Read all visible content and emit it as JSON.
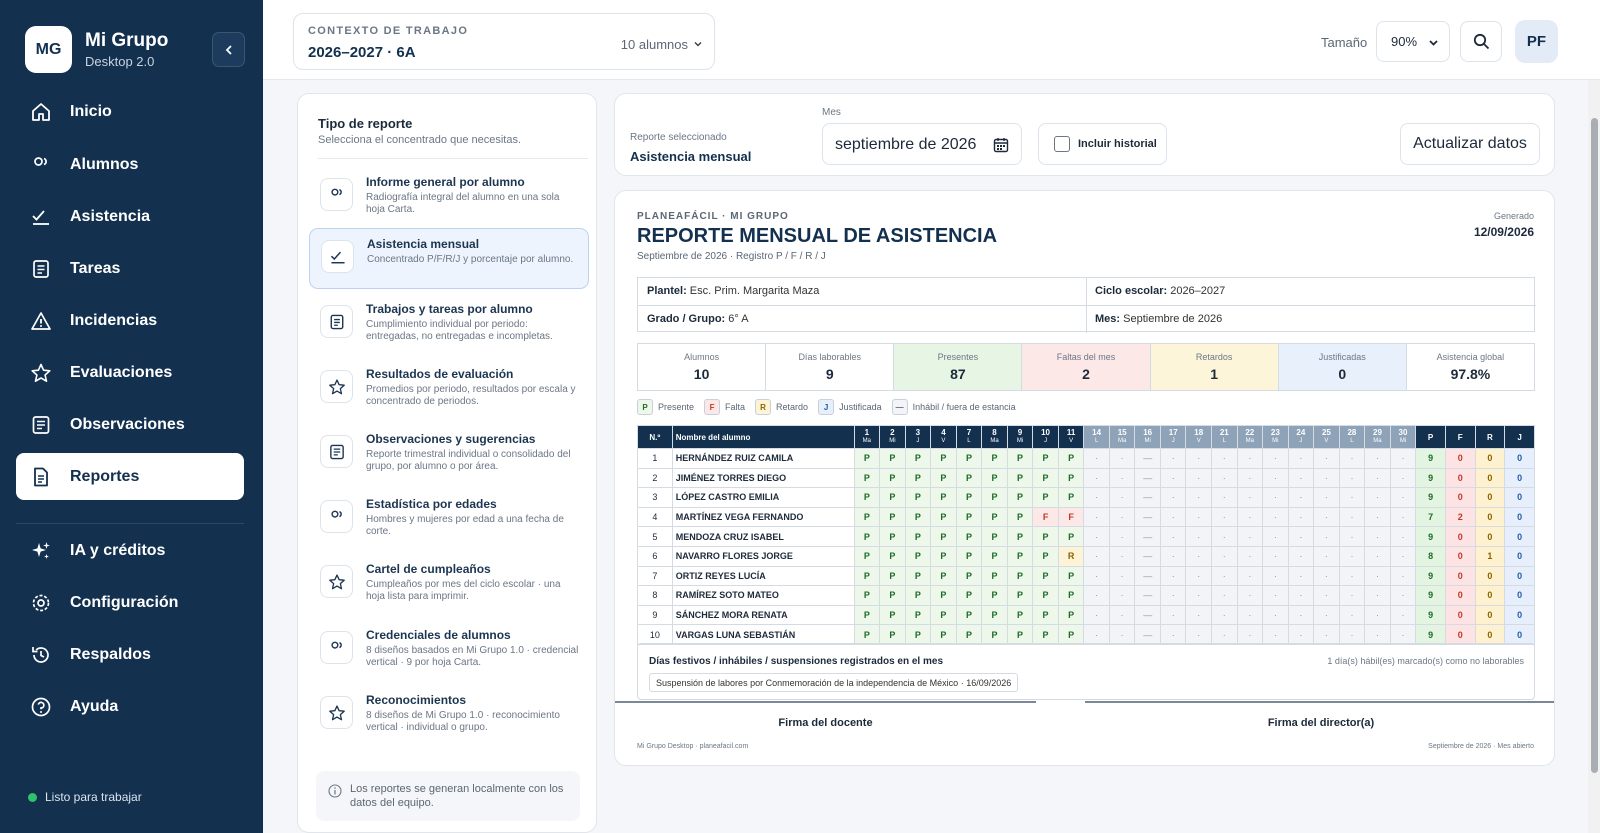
{
  "app": {
    "logo": "MG",
    "name": "Mi Grupo",
    "version": "Desktop 2.0"
  },
  "nav": [
    {
      "label": "Inicio",
      "icon": "home-icon"
    },
    {
      "label": "Alumnos",
      "icon": "users-icon"
    },
    {
      "label": "Asistencia",
      "icon": "check-list-icon"
    },
    {
      "label": "Tareas",
      "icon": "document-icon"
    },
    {
      "label": "Incidencias",
      "icon": "warning-icon"
    },
    {
      "label": "Evaluaciones",
      "icon": "star-icon"
    },
    {
      "label": "Observaciones",
      "icon": "notes-icon"
    },
    {
      "label": "Reportes",
      "icon": "report-icon",
      "active": true
    },
    {
      "label": "IA y créditos",
      "icon": "sparkles-icon"
    },
    {
      "label": "Configuración",
      "icon": "gear-icon"
    },
    {
      "label": "Respaldos",
      "icon": "history-icon"
    },
    {
      "label": "Ayuda",
      "icon": "help-icon"
    }
  ],
  "status": "Listo para trabajar",
  "context": {
    "label": "CONTEXTO DE TRABAJO",
    "value": "2026–2027 · 6A",
    "count": "10 alumnos"
  },
  "top": {
    "size_label": "Tamaño",
    "size_value": "90%",
    "avatar": "PF"
  },
  "report_types": {
    "title": "Tipo de reporte",
    "subtitle": "Selecciona el concentrado que necesitas.",
    "items": [
      {
        "name": "Informe general por alumno",
        "desc": "Radiografía integral del alumno en una sola hoja Carta.",
        "icon": "users-icon"
      },
      {
        "name": "Asistencia mensual",
        "desc": "Concentrado P/F/R/J y porcentaje por alumno.",
        "icon": "check-list-icon",
        "active": true
      },
      {
        "name": "Trabajos y tareas por alumno",
        "desc": "Cumplimiento individual por periodo: entregadas, no entregadas e incompletas.",
        "icon": "document-icon"
      },
      {
        "name": "Resultados de evaluación",
        "desc": "Promedios por periodo, resultados por escala y concentrado de periodos.",
        "icon": "star-icon"
      },
      {
        "name": "Observaciones y sugerencias",
        "desc": "Reporte trimestral individual o consolidado del grupo, por alumno o por área.",
        "icon": "notes-icon"
      },
      {
        "name": "Estadística por edades",
        "desc": "Hombres y mujeres por edad a una fecha de corte.",
        "icon": "users-icon"
      },
      {
        "name": "Cartel de cumpleaños",
        "desc": "Cumpleaños por mes del ciclo escolar · una hoja lista para imprimir.",
        "icon": "star-icon"
      },
      {
        "name": "Credenciales de alumnos",
        "desc": "8 diseños basados en Mi Grupo 1.0 · credencial vertical · 9 por hoja Carta.",
        "icon": "users-icon"
      },
      {
        "name": "Reconocimientos",
        "desc": "8 diseños de Mi Grupo 1.0 · reconocimiento vertical · individual o grupo.",
        "icon": "star-icon"
      }
    ],
    "note": "Los reportes se generan localmente con los datos del equipo."
  },
  "filters": {
    "selected_label": "Reporte seleccionado",
    "selected_value": "Asistencia mensual",
    "month_label": "Mes",
    "month_value": "septiembre de 2026",
    "history_label": "Incluir historial",
    "refresh_label": "Actualizar datos"
  },
  "report": {
    "org": "PLANEAFÁCIL · MI GRUPO",
    "title": "REPORTE MENSUAL DE ASISTENCIA",
    "subtitle": "Septiembre de 2026 · Registro P / F / R / J",
    "generated_label": "Generado",
    "generated_value": "12/09/2026",
    "info": {
      "plantel_k": "Plantel:",
      "plantel_v": "Esc. Prim. Margarita Maza",
      "ciclo_k": "Ciclo escolar:",
      "ciclo_v": "2026–2027",
      "grado_k": "Grado / Grupo:",
      "grado_v": "6° A",
      "mes_k": "Mes:",
      "mes_v": "Septiembre de 2026"
    },
    "stats": [
      {
        "label": "Alumnos",
        "value": "10",
        "bg": "#ffffff"
      },
      {
        "label": "Días laborables",
        "value": "9",
        "bg": "#ffffff"
      },
      {
        "label": "Presentes",
        "value": "87",
        "bg": "#e7f6e4"
      },
      {
        "label": "Faltas del mes",
        "value": "2",
        "bg": "#fde8e8"
      },
      {
        "label": "Retardos",
        "value": "1",
        "bg": "#fdf5da"
      },
      {
        "label": "Justificadas",
        "value": "0",
        "bg": "#e8f0fb"
      },
      {
        "label": "Asistencia global",
        "value": "97.8%",
        "bg": "#ffffff"
      }
    ],
    "legend": [
      {
        "k": "P",
        "label": "Presente",
        "color": "#eef8ea",
        "fg": "#1d6b2a"
      },
      {
        "k": "F",
        "label": "Falta",
        "color": "#fde8e8",
        "fg": "#c0392b"
      },
      {
        "k": "R",
        "label": "Retardo",
        "color": "#fdf4d8",
        "fg": "#8a6300"
      },
      {
        "k": "J",
        "label": "Justificada",
        "color": "#e6effb",
        "fg": "#245ea8"
      },
      {
        "k": "—",
        "label": "Inhábil / fuera de estancia",
        "color": "#f2f4f7",
        "fg": "#5b6775"
      }
    ],
    "table": {
      "col_num": "N.º",
      "col_name": "Nombre del alumno",
      "days": [
        [
          "1",
          "Ma"
        ],
        [
          "2",
          "Mi"
        ],
        [
          "3",
          "J"
        ],
        [
          "4",
          "V"
        ],
        [
          "7",
          "L"
        ],
        [
          "8",
          "Ma"
        ],
        [
          "9",
          "Mi"
        ],
        [
          "10",
          "J"
        ],
        [
          "11",
          "V"
        ],
        [
          "14",
          "L"
        ],
        [
          "15",
          "Ma"
        ],
        [
          "16",
          "Mi"
        ],
        [
          "17",
          "J"
        ],
        [
          "18",
          "V"
        ],
        [
          "21",
          "L"
        ],
        [
          "22",
          "Ma"
        ],
        [
          "23",
          "Mi"
        ],
        [
          "24",
          "J"
        ],
        [
          "25",
          "V"
        ],
        [
          "28",
          "L"
        ],
        [
          "29",
          "Ma"
        ],
        [
          "30",
          "Mi"
        ]
      ],
      "sum_cols": [
        "P",
        "F",
        "R",
        "J"
      ],
      "rows": [
        {
          "n": "1",
          "name": "HERNÁNDEZ RUIZ CAMILA",
          "marks": "PPPPPPPPP",
          "P": "9",
          "F": "0",
          "R": "0",
          "J": "0"
        },
        {
          "n": "2",
          "name": "JIMÉNEZ TORRES DIEGO",
          "marks": "PPPPPPPPP",
          "P": "9",
          "F": "0",
          "R": "0",
          "J": "0"
        },
        {
          "n": "3",
          "name": "LÓPEZ CASTRO EMILIA",
          "marks": "PPPPPPPPP",
          "P": "9",
          "F": "0",
          "R": "0",
          "J": "0"
        },
        {
          "n": "4",
          "name": "MARTÍNEZ VEGA FERNANDO",
          "marks": "PPPPPPPFF",
          "P": "7",
          "F": "2",
          "R": "0",
          "J": "0"
        },
        {
          "n": "5",
          "name": "MENDOZA CRUZ ISABEL",
          "marks": "PPPPPPPPP",
          "P": "9",
          "F": "0",
          "R": "0",
          "J": "0"
        },
        {
          "n": "6",
          "name": "NAVARRO FLORES JORGE",
          "marks": "PPPPPPPPR",
          "P": "8",
          "F": "0",
          "R": "1",
          "J": "0"
        },
        {
          "n": "7",
          "name": "ORTIZ REYES LUCÍA",
          "marks": "PPPPPPPPP",
          "P": "9",
          "F": "0",
          "R": "0",
          "J": "0"
        },
        {
          "n": "8",
          "name": "RAMÍREZ SOTO MATEO",
          "marks": "PPPPPPPPP",
          "P": "9",
          "F": "0",
          "R": "0",
          "J": "0"
        },
        {
          "n": "9",
          "name": "SÁNCHEZ MORA RENATA",
          "marks": "PPPPPPPPP",
          "P": "9",
          "F": "0",
          "R": "0",
          "J": "0"
        },
        {
          "n": "10",
          "name": "VARGAS LUNA SEBASTIÁN",
          "marks": "PPPPPPPPP",
          "P": "9",
          "F": "0",
          "R": "0",
          "J": "0"
        }
      ]
    },
    "festivos": {
      "title": "Días festivos / inhábiles / suspensiones registrados en el mes",
      "note": "1 día(s) hábil(es) marcado(s) como no laborables",
      "chip": "Suspensión de labores por Conmemoración de la independencia de México · 16/09/2026"
    },
    "sign_teacher": "Firma del docente",
    "sign_director": "Firma del director(a)",
    "footer_left": "Mi Grupo Desktop · planeafacil.com",
    "footer_right": "Septiembre de 2026 · Mes abierto"
  }
}
